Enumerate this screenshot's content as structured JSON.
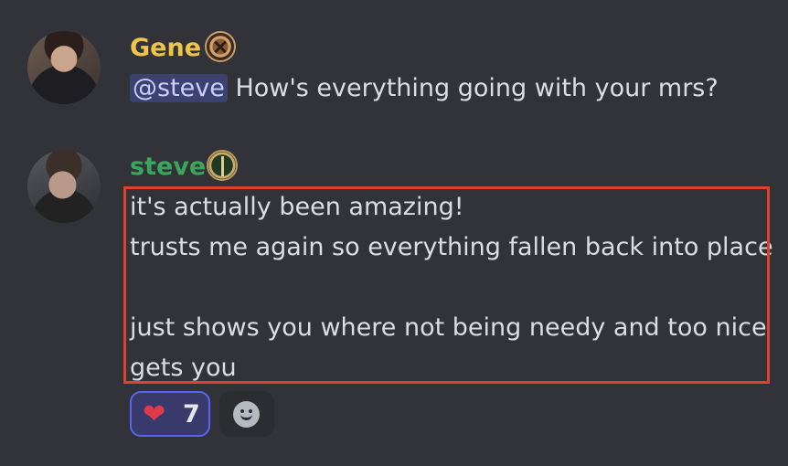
{
  "messages": [
    {
      "author": "Gene",
      "author_color": "#f0c34a",
      "badge_icon": "crossed-swords-badge-icon",
      "mention": "@steve",
      "text": "How's everything going with your mrs?"
    },
    {
      "author": "steve",
      "author_color": "#3ba55c",
      "badge_icon": "sword-badge-icon",
      "lines": [
        "it's actually been amazing!",
        "trusts me again so everything fallen back into place",
        "just shows you where not being needy and too nice",
        "gets you"
      ],
      "reactions": [
        {
          "emoji": "❤",
          "count": "7",
          "selected": true
        }
      ],
      "add_reaction_icon": "smiley-icon"
    }
  ],
  "colors": {
    "background": "#313338",
    "highlight_border": "#e0412d",
    "mention_bg": "#3c4270",
    "reaction_border": "#5865f2"
  }
}
